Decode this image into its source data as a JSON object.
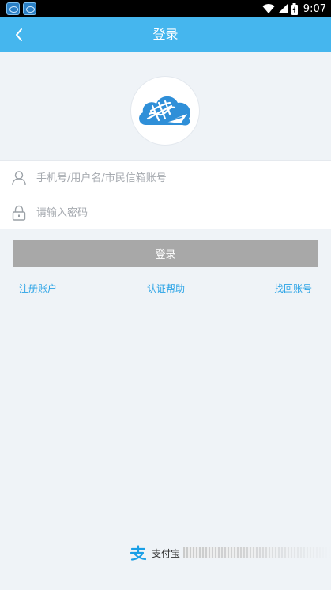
{
  "status_bar": {
    "time": "9:07",
    "left_icons": [
      "app-notification-icon",
      "app-notification-icon"
    ],
    "right_icons": [
      "wifi-icon",
      "signal-icon",
      "battery-icon"
    ]
  },
  "app_bar": {
    "title": "登录",
    "back_icon": "chevron-left-icon",
    "background": "#45b6ee"
  },
  "logo": {
    "icon": "cloud-logo-icon"
  },
  "form": {
    "username": {
      "icon": "user-icon",
      "placeholder": "手机号/用户名/市民信箱账号",
      "value": ""
    },
    "password": {
      "icon": "lock-icon",
      "placeholder": "请输入密码",
      "value": ""
    }
  },
  "login_button": {
    "label": "登录",
    "background": "#a8a8a8"
  },
  "links": {
    "register": "注册账户",
    "help": "认证帮助",
    "recover": "找回账号",
    "color": "#2aa3e6"
  },
  "footer": {
    "icon": "alipay-icon",
    "label": "支付宝"
  }
}
